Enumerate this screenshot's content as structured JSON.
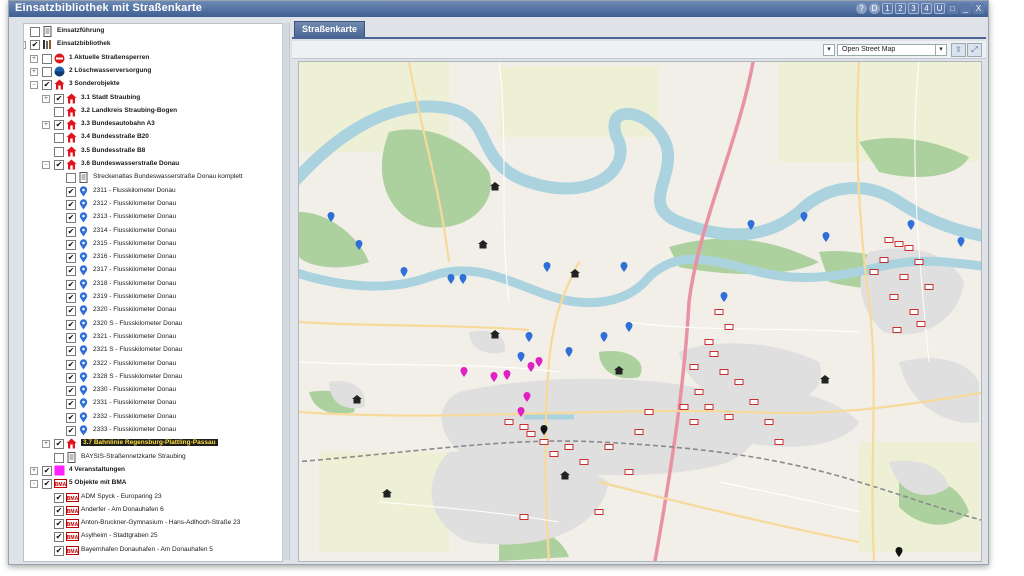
{
  "window": {
    "title": "Einsatzbibliothek mit Straßenkarte"
  },
  "titlebar": {
    "buttons": [
      "?",
      "D",
      "1",
      "2",
      "3",
      "4",
      "U",
      "□",
      "_",
      "X"
    ]
  },
  "tree": {
    "items": [
      {
        "label": "Einsatzführung",
        "level": 0,
        "expander": "",
        "checked": false,
        "icon": "document-icon",
        "bold": true
      },
      {
        "label": "Einsatzbibliothek",
        "level": 0,
        "expander": "-",
        "checked": true,
        "icon": "library-icon",
        "bold": true
      },
      {
        "label": "1 Aktuelle Straßensperren",
        "level": 1,
        "expander": "+",
        "checked": false,
        "icon": "road-block-icon",
        "bold": true
      },
      {
        "label": "2 Löschwasserversorgung",
        "level": 1,
        "expander": "+",
        "checked": false,
        "icon": "water-supply-icon",
        "bold": true
      },
      {
        "label": "3 Sonderobjekte",
        "level": 1,
        "expander": "-",
        "checked": true,
        "icon": "special-object-icon",
        "bold": true
      },
      {
        "label": "3.1 Stadt Straubing",
        "level": 2,
        "expander": "+",
        "checked": true,
        "icon": "special-object-icon",
        "bold": true
      },
      {
        "label": "3.2 Landkreis Straubing-Bogen",
        "level": 2,
        "expander": "",
        "checked": false,
        "icon": "special-object-icon",
        "bold": true
      },
      {
        "label": "3.3 Bundesautobahn A3",
        "level": 2,
        "expander": "+",
        "checked": true,
        "icon": "special-object-icon",
        "bold": true
      },
      {
        "label": "3.4 Bundesstraße B20",
        "level": 2,
        "expander": "",
        "checked": false,
        "icon": "special-object-icon",
        "bold": true
      },
      {
        "label": "3.5 Bundesstraße B8",
        "level": 2,
        "expander": "",
        "checked": false,
        "icon": "special-object-icon",
        "bold": true
      },
      {
        "label": "3.6 Bundeswasserstraße Donau",
        "level": 2,
        "expander": "-",
        "checked": true,
        "icon": "special-object-icon",
        "bold": true
      },
      {
        "label": "Streckenatlas Bundeswasserstraße Donau komplett",
        "level": 3,
        "expander": "",
        "checked": false,
        "icon": "document-icon",
        "bold": false
      },
      {
        "label": "2311 - Flusskilometer Donau",
        "level": 3,
        "expander": "",
        "checked": true,
        "icon": "map-pin-icon",
        "bold": false
      },
      {
        "label": "2312 - Flusskilometer Donau",
        "level": 3,
        "expander": "",
        "checked": true,
        "icon": "map-pin-icon",
        "bold": false
      },
      {
        "label": "2313 - Flusskilometer Donau",
        "level": 3,
        "expander": "",
        "checked": true,
        "icon": "map-pin-icon",
        "bold": false
      },
      {
        "label": "2314 - Flusskilometer Donau",
        "level": 3,
        "expander": "",
        "checked": true,
        "icon": "map-pin-icon",
        "bold": false
      },
      {
        "label": "2315 - Flusskilometer Donau",
        "level": 3,
        "expander": "",
        "checked": true,
        "icon": "map-pin-icon",
        "bold": false
      },
      {
        "label": "2316 - Flusskilometer Donau",
        "level": 3,
        "expander": "",
        "checked": true,
        "icon": "map-pin-icon",
        "bold": false
      },
      {
        "label": "2317 - Flusskilometer Donau",
        "level": 3,
        "expander": "",
        "checked": true,
        "icon": "map-pin-icon",
        "bold": false
      },
      {
        "label": "2318 - Flusskilometer Donau",
        "level": 3,
        "expander": "",
        "checked": true,
        "icon": "map-pin-icon",
        "bold": false
      },
      {
        "label": "2319 - Flusskilometer Donau",
        "level": 3,
        "expander": "",
        "checked": true,
        "icon": "map-pin-icon",
        "bold": false
      },
      {
        "label": "2320 - Flusskilometer Donau",
        "level": 3,
        "expander": "",
        "checked": true,
        "icon": "map-pin-icon",
        "bold": false
      },
      {
        "label": "2320 S - Flusskilometer Donau",
        "level": 3,
        "expander": "",
        "checked": true,
        "icon": "map-pin-icon",
        "bold": false
      },
      {
        "label": "2321 - Flusskilometer Donau",
        "level": 3,
        "expander": "",
        "checked": true,
        "icon": "map-pin-icon",
        "bold": false
      },
      {
        "label": "2321 S - Flusskilometer Donau",
        "level": 3,
        "expander": "",
        "checked": true,
        "icon": "map-pin-icon",
        "bold": false
      },
      {
        "label": "2322 - Flusskilometer Donau",
        "level": 3,
        "expander": "",
        "checked": true,
        "icon": "map-pin-icon",
        "bold": false
      },
      {
        "label": "2328 S - Flusskilometer Donau",
        "level": 3,
        "expander": "",
        "checked": true,
        "icon": "map-pin-icon",
        "bold": false
      },
      {
        "label": "2330 - Flusskilometer Donau",
        "level": 3,
        "expander": "",
        "checked": true,
        "icon": "map-pin-icon",
        "bold": false
      },
      {
        "label": "2331 - Flusskilometer Donau",
        "level": 3,
        "expander": "",
        "checked": true,
        "icon": "map-pin-icon",
        "bold": false
      },
      {
        "label": "2332 - Flusskilometer Donau",
        "level": 3,
        "expander": "",
        "checked": true,
        "icon": "map-pin-icon",
        "bold": false
      },
      {
        "label": "2333 - Flusskilometer Donau",
        "level": 3,
        "expander": "",
        "checked": true,
        "icon": "map-pin-icon",
        "bold": false
      },
      {
        "label": "3.7 Bahnlinie Regensburg-Plattling-Passau",
        "level": 2,
        "expander": "+",
        "checked": true,
        "icon": "special-object-icon",
        "bold": true,
        "selected": true
      },
      {
        "label": "BAYSIS-Straßennetzkarte Straubing",
        "level": 2,
        "expander": "",
        "checked": false,
        "icon": "document-icon",
        "bold": false
      },
      {
        "label": "4 Veranstaltungen",
        "level": 1,
        "expander": "+",
        "checked": true,
        "icon": "event-icon",
        "bold": true
      },
      {
        "label": "5 Objekte mit BMA",
        "level": 1,
        "expander": "-",
        "checked": true,
        "icon": "bma-icon",
        "bold": true
      },
      {
        "label": "ADM Spyck - Europaring 23",
        "level": 2,
        "expander": "",
        "checked": true,
        "icon": "bma-icon",
        "bold": false
      },
      {
        "label": "Anderfer - Am Donauhafen 6",
        "level": 2,
        "expander": "",
        "checked": true,
        "icon": "bma-icon",
        "bold": false
      },
      {
        "label": "Anton-Bruckner-Gymnasium - Hans-Adlhoch-Straße 23",
        "level": 2,
        "expander": "",
        "checked": true,
        "icon": "bma-icon",
        "bold": false
      },
      {
        "label": "Asylheim - Stadtgraben 25",
        "level": 2,
        "expander": "",
        "checked": true,
        "icon": "bma-icon",
        "bold": false
      },
      {
        "label": "Bayernhafen Donauhafen - Am Donauhafen 5",
        "level": 2,
        "expander": "",
        "checked": true,
        "icon": "bma-icon",
        "bold": false
      }
    ],
    "bma_badge": "BMA"
  },
  "panel": {
    "tab_label": "Straßenkarte",
    "map_select": "Open Street Map",
    "dropdown_arrow": "▾"
  },
  "colors": {
    "titlebar": "#4a6594",
    "river": "#aad3df",
    "forest": "#add19e",
    "residential": "#e0dfdf",
    "motorway": "#e892a2",
    "pin_blue": "#2e6fd8",
    "pin_magenta": "#e020c0",
    "bma_red": "#c00000"
  }
}
